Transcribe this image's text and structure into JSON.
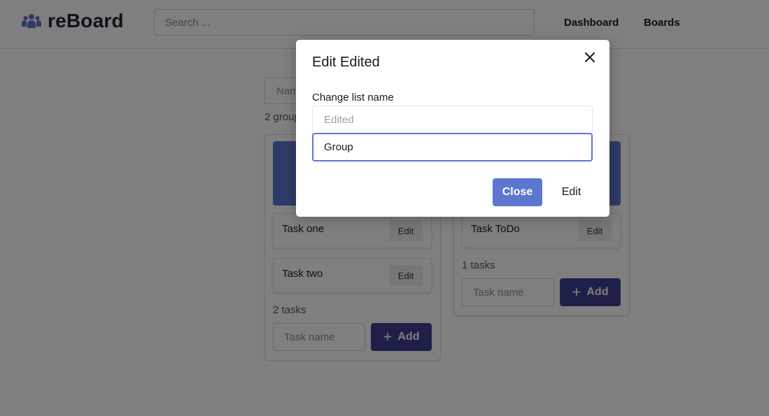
{
  "app": {
    "name": "reBoard",
    "logo_icon": "users-icon"
  },
  "header": {
    "search_placeholder": "Search ...",
    "nav": [
      "Dashboard",
      "Boards"
    ]
  },
  "board": {
    "group_name_placeholder": "Name",
    "groups_count_text": "2 groups",
    "columns": [
      {
        "tasks": [
          {
            "name": "Task one",
            "edit_label": "Edit"
          },
          {
            "name": "Task two",
            "edit_label": "Edit"
          }
        ],
        "tasks_count_text": "2 tasks",
        "task_input_placeholder": "Task name",
        "add_label": "Add"
      },
      {
        "tasks": [
          {
            "name": "Task ToDo",
            "edit_label": "Edit"
          }
        ],
        "tasks_count_text": "1 tasks",
        "task_input_placeholder": "Task name",
        "add_label": "Add"
      }
    ]
  },
  "modal": {
    "title": "Edit Edited",
    "label": "Change list name",
    "current_name_placeholder": "Edited",
    "new_name_value": "Group",
    "close_label": "Close",
    "edit_label": "Edit",
    "close_icon": "close-icon"
  },
  "colors": {
    "accent": "#5d77d0",
    "primary_dark": "#3c4192",
    "overlay": "rgba(0,0,0,0.5)"
  }
}
